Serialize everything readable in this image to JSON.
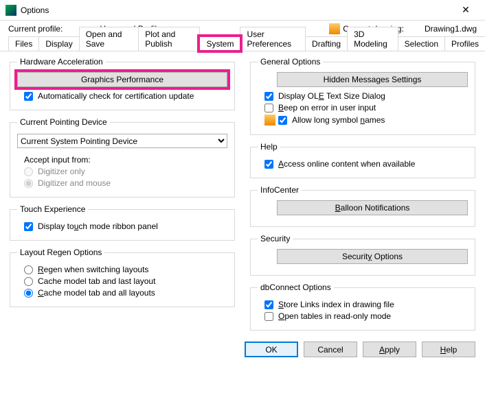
{
  "window": {
    "title": "Options"
  },
  "header": {
    "profile_label": "Current profile:",
    "profile_name": "<<Unnamed Profile>>",
    "drawing_label": "Current drawing:",
    "drawing_name": "Drawing1.dwg"
  },
  "tabs": [
    "Files",
    "Display",
    "Open and Save",
    "Plot and Publish",
    "System",
    "User Preferences",
    "Drafting",
    "3D Modeling",
    "Selection",
    "Profiles"
  ],
  "active_tab_index": 4,
  "left": {
    "hw_accel": {
      "legend": "Hardware Acceleration",
      "btn": "Graphics Performance",
      "chk_cert": "Automatically check for certification update",
      "chk_cert_val": true
    },
    "pointing": {
      "legend": "Current Pointing Device",
      "select_value": "Current System Pointing Device",
      "accept_label": "Accept input from:",
      "r1": "Digitizer only",
      "r2": "Digitizer and mouse"
    },
    "touch": {
      "legend": "Touch Experience",
      "chk": "Display touch mode ribbon panel",
      "chk_val": true
    },
    "regen": {
      "legend": "Layout Regen Options",
      "r1": "Regen when switching layouts",
      "r2": "Cache model tab and last layout",
      "r3": "Cache model tab and all layouts"
    }
  },
  "right": {
    "general": {
      "legend": "General Options",
      "btn": "Hidden Messages Settings",
      "c1": "Display OLE Text Size Dialog",
      "c1v": true,
      "c2": "Beep on error in user input",
      "c2v": false,
      "c3": "Allow long symbol names",
      "c3v": true
    },
    "help": {
      "legend": "Help",
      "c1": "Access online content when available",
      "c1v": true
    },
    "info": {
      "legend": "InfoCenter",
      "btn": "Balloon Notifications"
    },
    "sec": {
      "legend": "Security",
      "btn": "Security Options"
    },
    "dbc": {
      "legend": "dbConnect Options",
      "c1": "Store Links index in drawing file",
      "c1v": true,
      "c2": "Open tables in read-only mode",
      "c2v": false
    }
  },
  "footer": {
    "ok": "OK",
    "cancel": "Cancel",
    "apply": "Apply",
    "help": "Help"
  }
}
